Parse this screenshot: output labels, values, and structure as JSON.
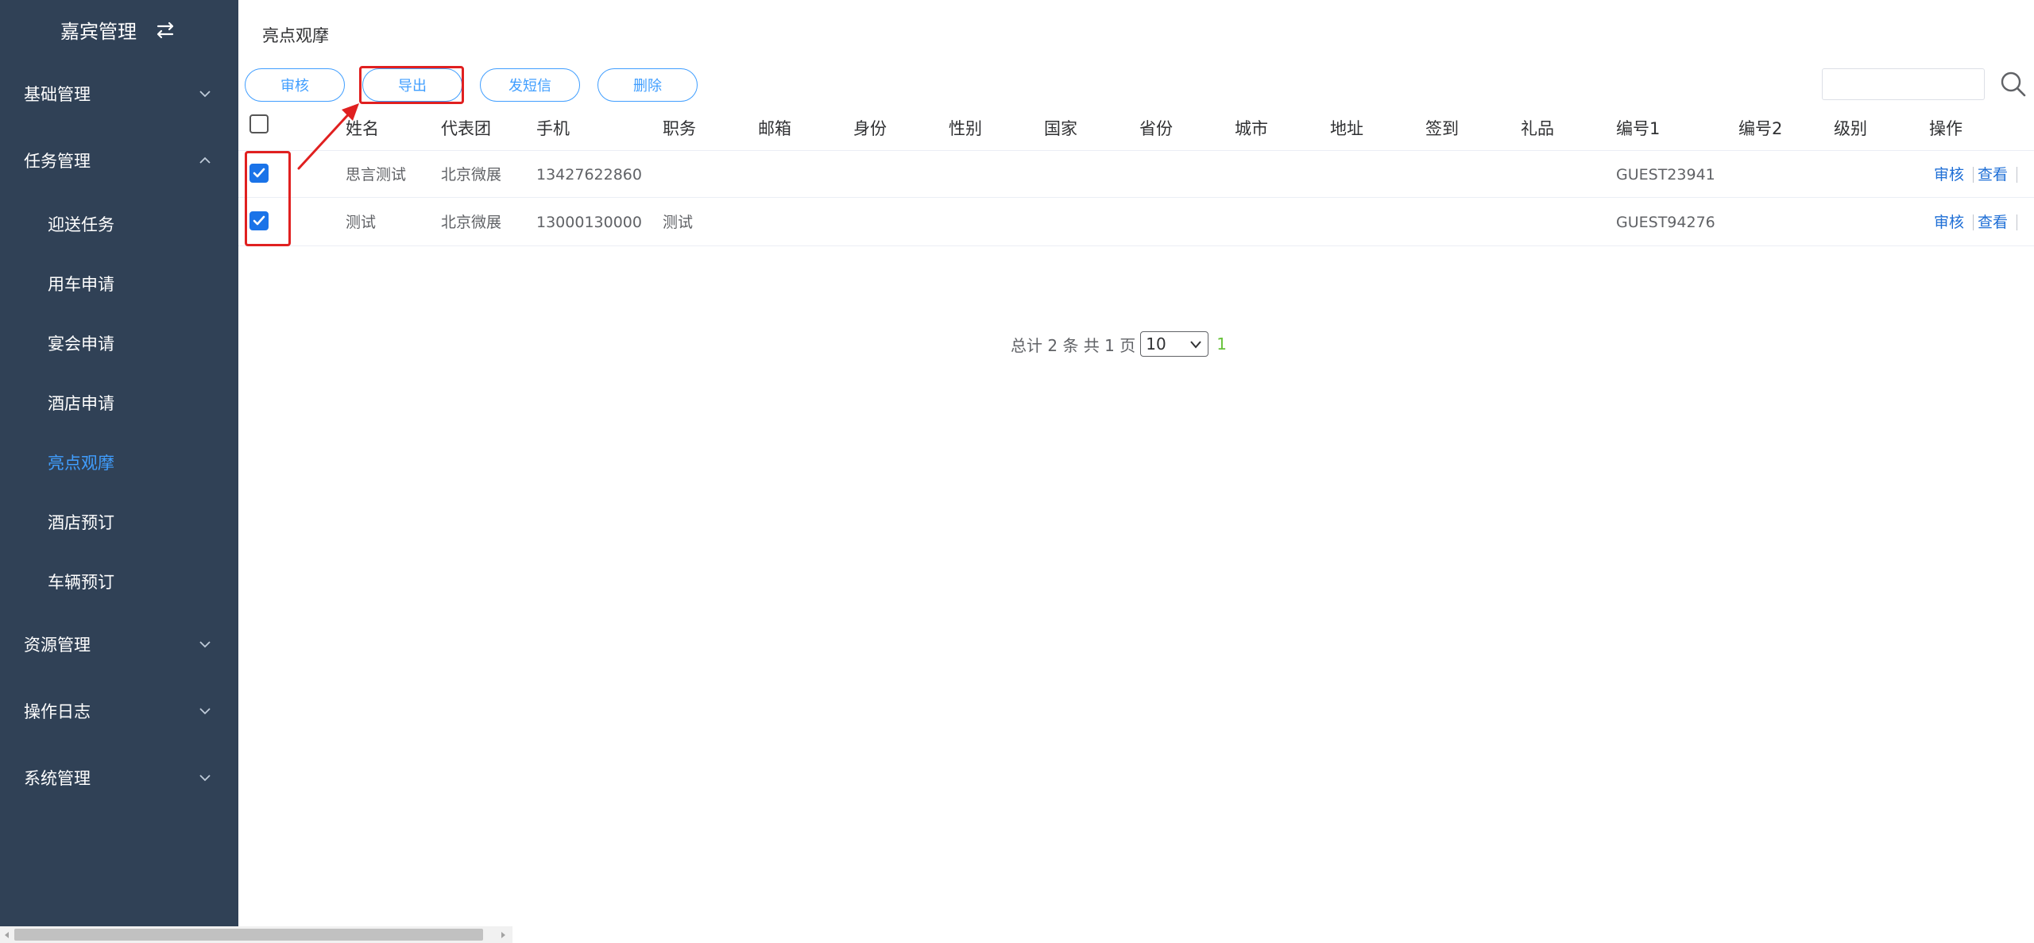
{
  "app": {
    "title": "嘉宾管理"
  },
  "sidebar": {
    "groups": [
      {
        "label": "基础管理"
      },
      {
        "label": "任务管理"
      },
      {
        "label": "资源管理"
      },
      {
        "label": "操作日志"
      },
      {
        "label": "系统管理"
      }
    ],
    "task_items": [
      {
        "label": "迎送任务"
      },
      {
        "label": "用车申请"
      },
      {
        "label": "宴会申请"
      },
      {
        "label": "酒店申请"
      },
      {
        "label": "亮点观摩",
        "active": true
      },
      {
        "label": "酒店预订"
      },
      {
        "label": "车辆预订"
      }
    ]
  },
  "breadcrumb": "亮点观摩",
  "toolbar": {
    "audit": "审核",
    "export": "导出",
    "sms": "发短信",
    "delete": "删除"
  },
  "search": {
    "value": ""
  },
  "table": {
    "columns": [
      "姓名",
      "代表团",
      "手机",
      "职务",
      "邮箱",
      "身份",
      "性别",
      "国家",
      "省份",
      "城市",
      "地址",
      "签到",
      "礼品",
      "编号1",
      "编号2",
      "级别",
      "操作"
    ],
    "rows": [
      {
        "checked": true,
        "name": "思言测试",
        "delegation": "北京微展",
        "phone": "13427622860",
        "position": "",
        "code1": "GUEST23941"
      },
      {
        "checked": true,
        "name": "测试",
        "delegation": "北京微展",
        "phone": "13000130000",
        "position": "测试",
        "code1": "GUEST94276"
      }
    ],
    "row_actions": {
      "audit": "审核",
      "view": "查看"
    }
  },
  "pagination": {
    "summary": "总计 2 条  共 1 页",
    "page_size": "10",
    "current_page": "1"
  },
  "colors": {
    "sidebar_bg": "#304156",
    "accent": "#409eff",
    "annotation": "#e02020",
    "page_green": "#67c23a"
  }
}
